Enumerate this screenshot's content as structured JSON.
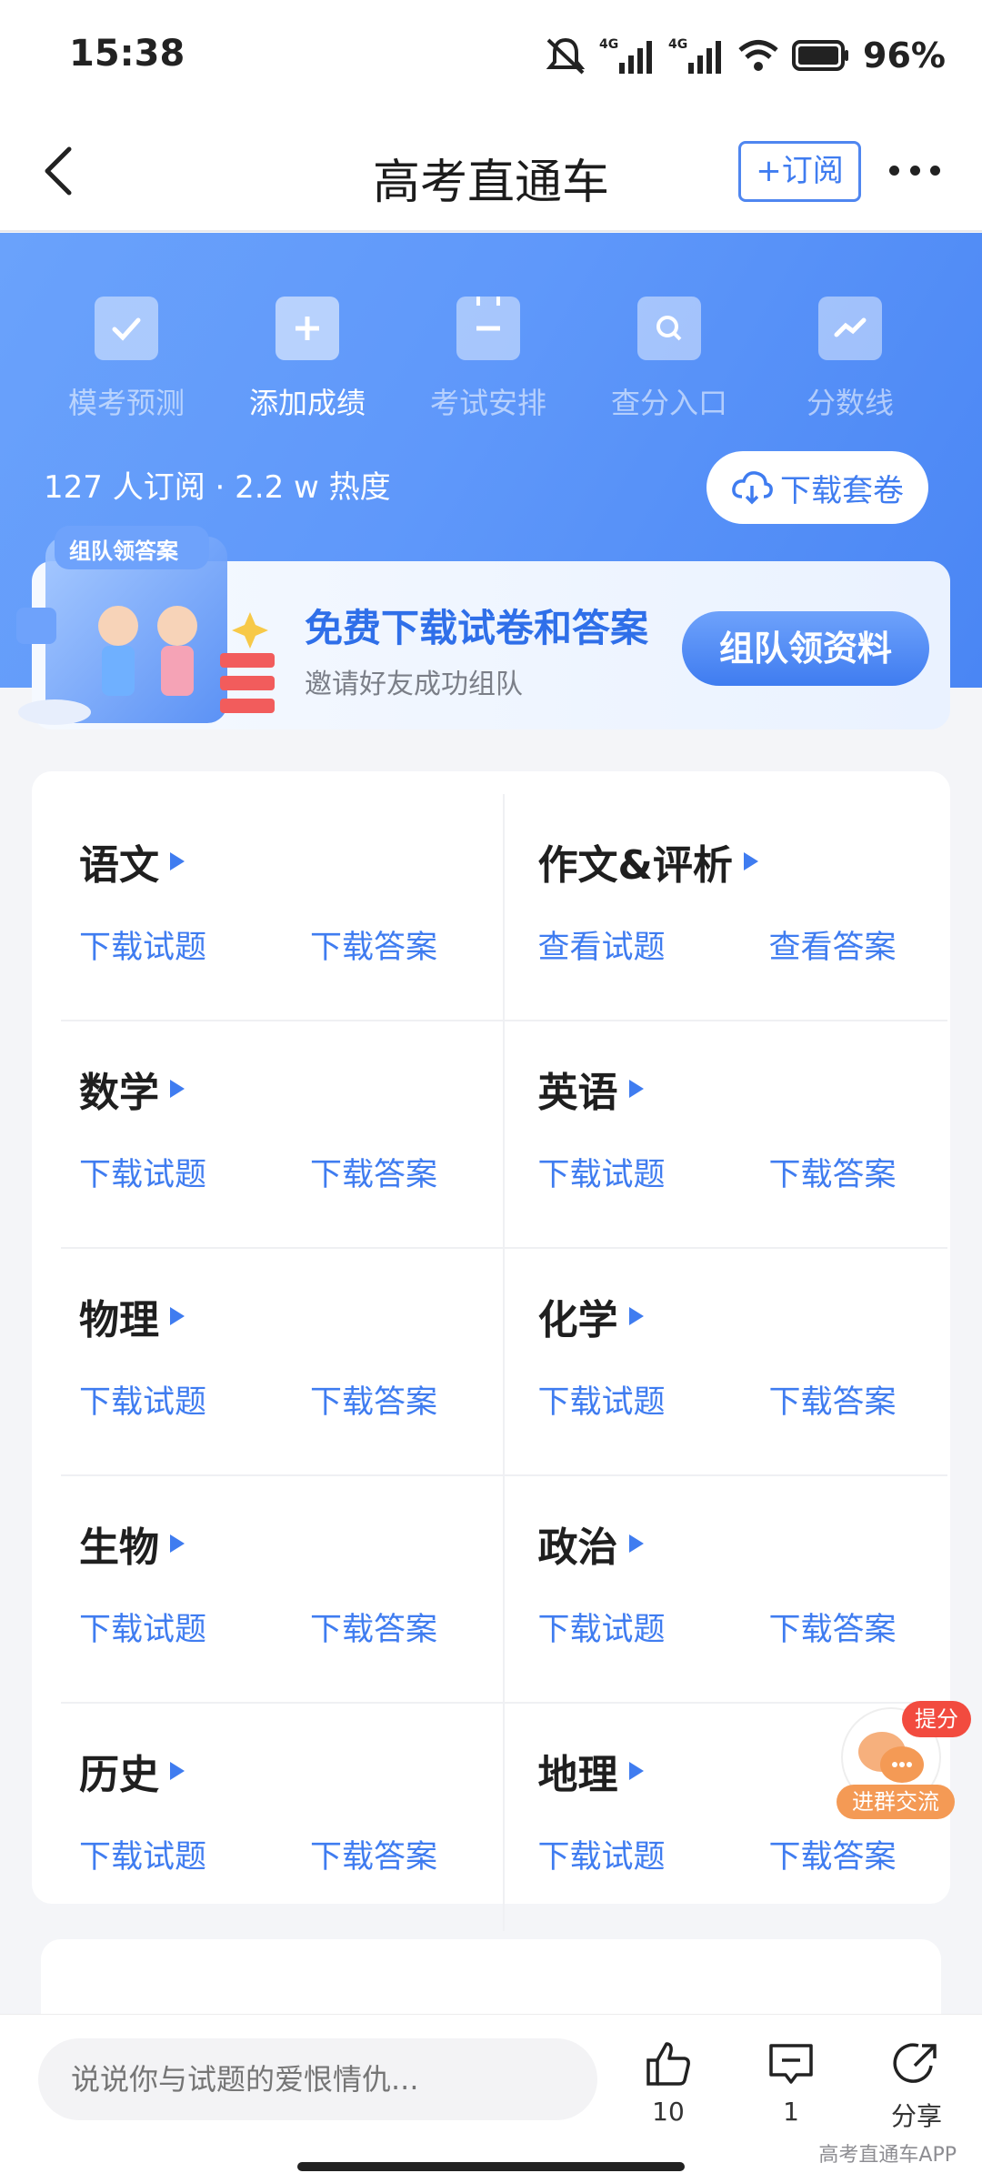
{
  "status_bar": {
    "time": "15:38",
    "network": "4G",
    "battery": "96%"
  },
  "nav": {
    "title": "高考直通车",
    "subscribe_label": "+订阅"
  },
  "quick_actions": [
    {
      "label": "模考预测",
      "icon": "check-icon",
      "active": false
    },
    {
      "label": "添加成绩",
      "icon": "plus-icon",
      "active": true
    },
    {
      "label": "考试安排",
      "icon": "calendar-icon",
      "active": false
    },
    {
      "label": "查分入口",
      "icon": "search-icon",
      "active": false
    },
    {
      "label": "分数线",
      "icon": "trend-icon",
      "active": false
    }
  ],
  "stats": {
    "text": "127 人订阅 · 2.2 w 热度"
  },
  "download_pack": {
    "label": "下载套卷"
  },
  "banner": {
    "art_title": "组队领答案",
    "title": "免费下载试卷和答案",
    "subtitle": "邀请好友成功组队",
    "button": "组队领资料"
  },
  "subjects": [
    {
      "name": "语文",
      "a": "下载试题",
      "b": "下载答案"
    },
    {
      "name": "作文&评析",
      "a": "查看试题",
      "b": "查看答案"
    },
    {
      "name": "数学",
      "a": "下载试题",
      "b": "下载答案"
    },
    {
      "name": "英语",
      "a": "下载试题",
      "b": "下载答案"
    },
    {
      "name": "物理",
      "a": "下载试题",
      "b": "下载答案"
    },
    {
      "name": "化学",
      "a": "下载试题",
      "b": "下载答案"
    },
    {
      "name": "生物",
      "a": "下载试题",
      "b": "下载答案"
    },
    {
      "name": "政治",
      "a": "下载试题",
      "b": "下载答案"
    },
    {
      "name": "历史",
      "a": "下载试题",
      "b": "下载答案"
    },
    {
      "name": "地理",
      "a": "下载试题",
      "b": "下载答案"
    }
  ],
  "float_chat": {
    "badge": "提分",
    "label": "进群交流"
  },
  "bottom": {
    "placeholder": "说说你与试题的爱恨情仇...",
    "like_count": "10",
    "comment_count": "1",
    "share_label": "分享",
    "watermark": "高考直通车APP"
  },
  "colors": {
    "brand": "#3f7cf0",
    "hero": "#5f98fa",
    "badge": "#f24b3f",
    "chat_orange": "#f49a55"
  }
}
